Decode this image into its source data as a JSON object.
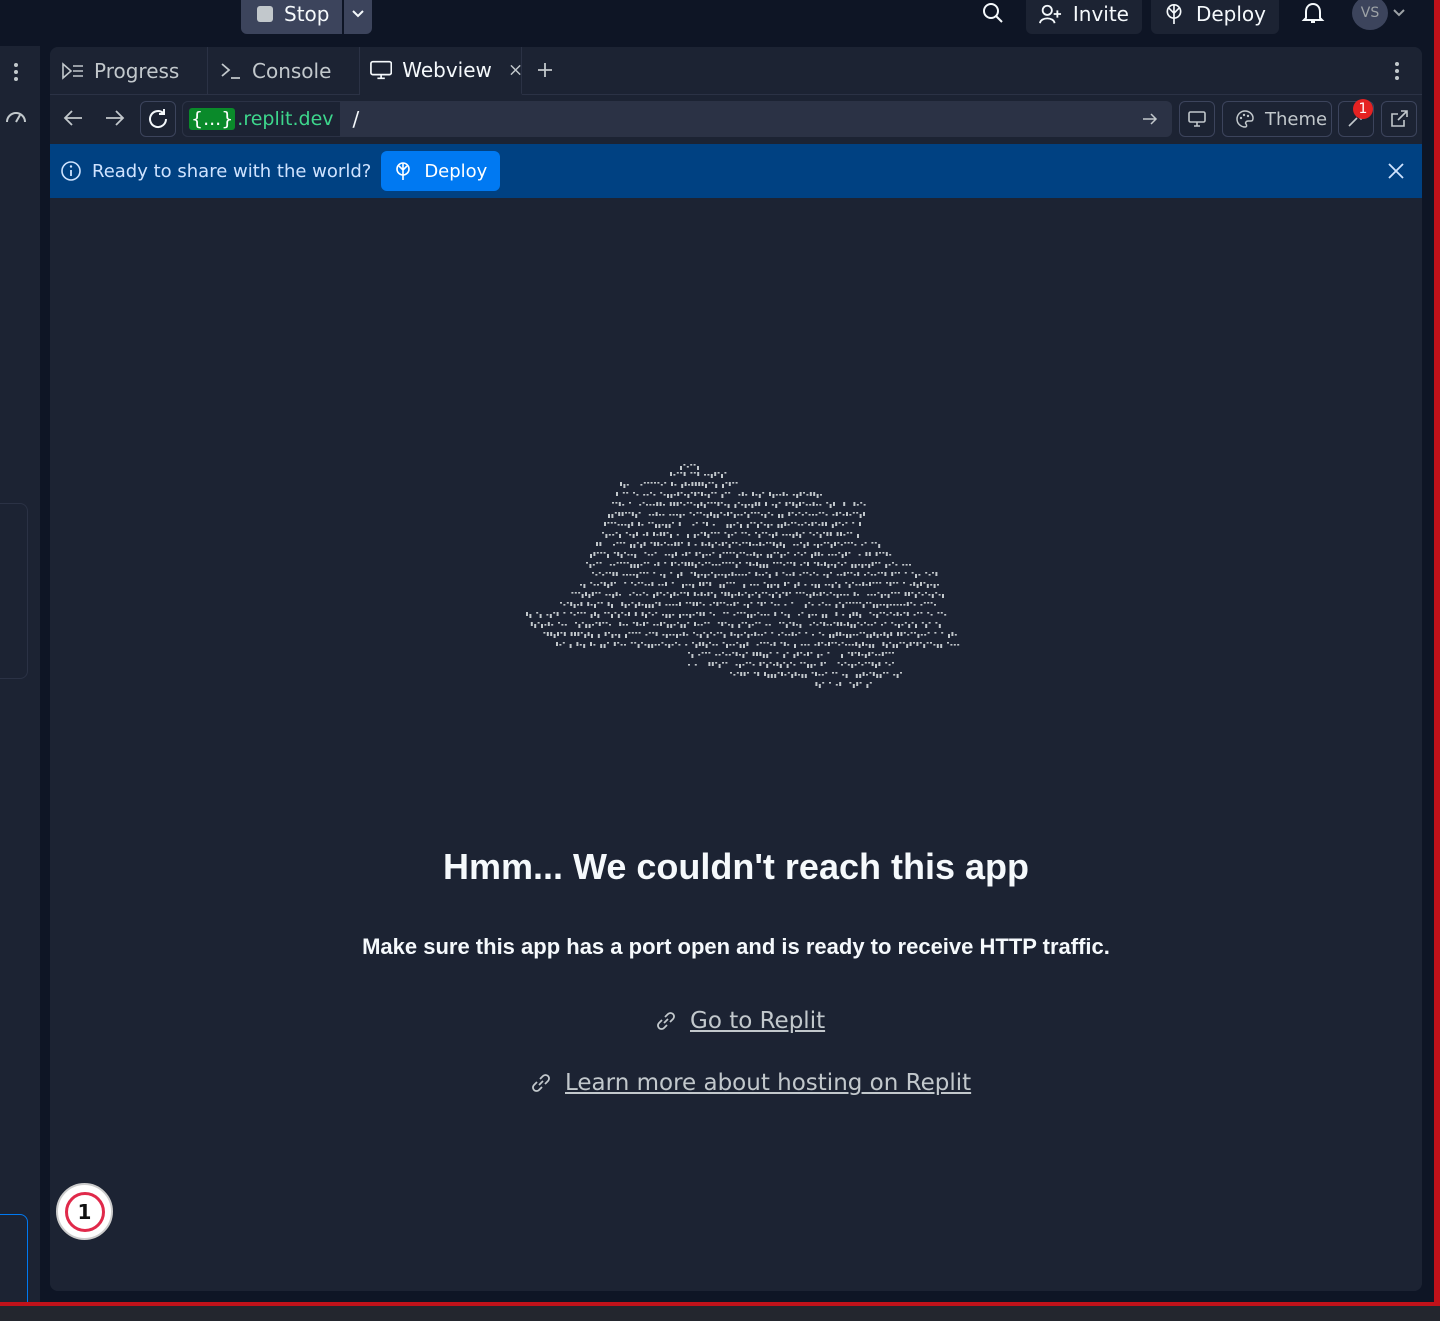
{
  "topbar": {
    "stop_label": "Stop",
    "invite_label": "Invite",
    "deploy_label": "Deploy",
    "avatar_initials": "VS"
  },
  "tabs": [
    {
      "label": "Progress",
      "icon": "progress-icon"
    },
    {
      "label": "Console",
      "icon": "terminal-icon"
    },
    {
      "label": "Webview",
      "icon": "monitor-icon"
    }
  ],
  "address": {
    "host_braces": "{...}",
    "host_suffix": ".replit.dev",
    "path": "/"
  },
  "toolbar": {
    "theme_label": "Theme",
    "devtools_badge": "1"
  },
  "banner": {
    "message": "Ready to share with the world?",
    "deploy_label": "Deploy"
  },
  "error": {
    "headline": "Hmm... We couldn't reach this app",
    "subline": "Make sure this app has a port open and is ready to receive HTTP traffic.",
    "link_replit": "Go to Replit",
    "link_hosting": "Learn more about hosting on Replit"
  },
  "notification_count": "1",
  "colors": {
    "background": "#0e1525",
    "panel": "#1c2333",
    "banner": "#004182",
    "accent": "#0079f2",
    "url_host": "#3dd68c"
  }
}
